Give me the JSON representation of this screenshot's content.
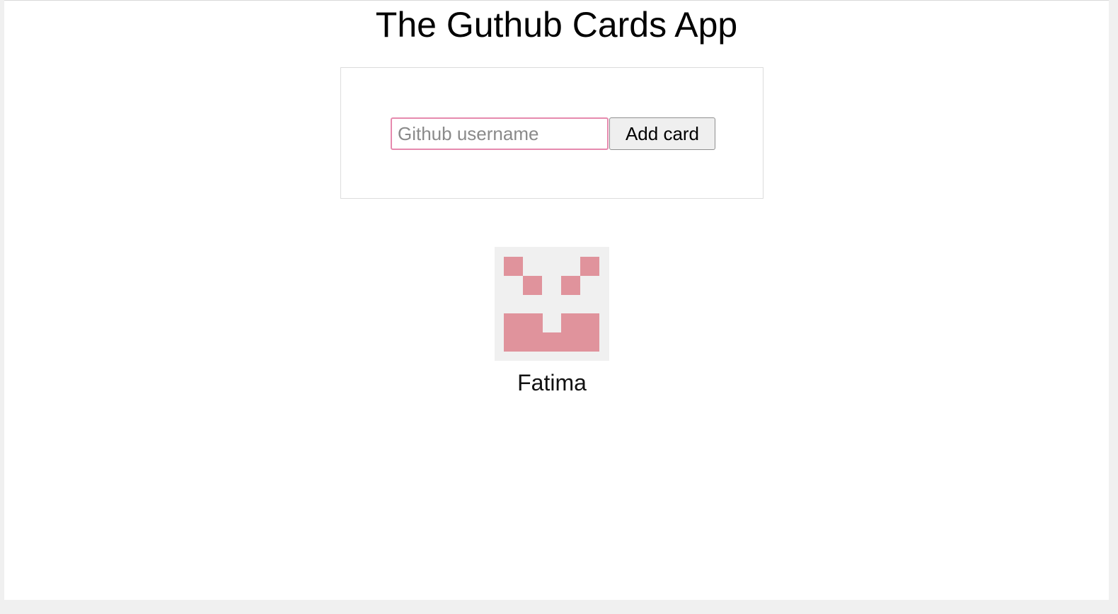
{
  "header": {
    "title": "The Guthub Cards App"
  },
  "form": {
    "username_placeholder": "Github username",
    "username_value": "",
    "add_button_label": "Add card"
  },
  "cards": [
    {
      "name": "Fatima",
      "avatar_icon": "identicon-avatar",
      "avatar_color": "#e0939c",
      "avatar_background": "#f0f0f0"
    }
  ],
  "colors": {
    "input_focus_border": "#e68aae"
  }
}
